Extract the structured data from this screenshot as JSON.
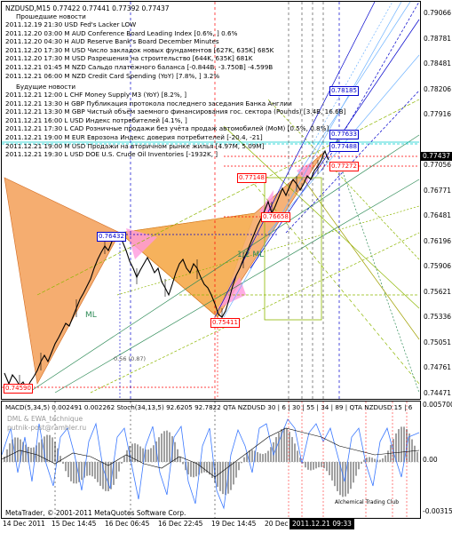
{
  "chart_header": "NZDUSD,M15  0.77422 0.77441 0.77392 0.77437",
  "news": {
    "past_title": "Прошедшие новости",
    "past": [
      "2011.12.19 21:30    USD Fed's Lacker  LOW",
      "2011.12.20 03:00 M AUD Conference Board Leading Index [0.6%, ] 0.6%",
      "2011.12.20 04:30 H AUD Reserve Bank's Board December Minutes",
      "2011.12.20 17:30 M USD Число закладок новых фундаментов [627K, 635K] 685K",
      "2011.12.20 17:30 M USD Разрешения на строительство [644K, 635K] 681K",
      "2011.12.21 01:45 M NZD Сальдо платёжного баланса [-0.844B, -3.750B] -4.599B",
      "2011.12.21 06:00 M NZD Credit Card Spending (YoY) [7.8%, ] 3.2%"
    ],
    "future_title": "Будущие новости",
    "future": [
      "2011.12.21 12:00 L CHF Money Supply M3 (YoY) [8.2%, ]",
      "2011.12.21 13:30 H GBP Публикация протокола последнего заседания Банка Англии",
      "2011.12.21 13:30 M GBP Чистый объём заемного финансирования гос. сектора (Pounds) [3.4B, 16.6B]",
      "2011.12.21 16:00 L USD Индекс потребителей [4.1%, ]",
      "2011.12.21 17:30 L CAD Розничные продажи без учёта продаж автомобилей (MoM) [0.5%, 0.8%]",
      "2011.12.21 19:00 M EUR Еврозона Индекс доверия потребителей [-20.4, -21]",
      "2011.12.21 19:00 M USD Продажи на вторичном рынке жилья [4.97M, 5.09M]",
      "2011.12.21 19:30 L USD DOE U.S. Crude Oil Inventories [-1932K, ]"
    ]
  },
  "price_axis": [
    "0.79066",
    "0.78781",
    "0.78481",
    "0.78206",
    "0.77916",
    "0.77437",
    "0.77056",
    "0.76771",
    "0.76481",
    "0.76196",
    "0.75906",
    "0.75621",
    "0.75336",
    "0.75051",
    "0.74761",
    "0.74471"
  ],
  "current_price": "0.77437",
  "price_labels": {
    "p1": "0.78185",
    "p2": "0.77633",
    "p3": "0.77488",
    "p4": "0.77272",
    "p5": "0.77148",
    "p6": "0.76432",
    "p7": "0.75411",
    "p8": "0.74590",
    "p9": "0.76658"
  },
  "chart_annotations": {
    "ml": "ML",
    "half": "1/2 ML",
    "fib": "0.56 (0.87)"
  },
  "macd": {
    "header": "MACD(5,34,5) 0.002491 0.002262  Stoch(34,13,5) 92.6205 92.7822  QTA NZDUSD 30 | 6 | 30 | 55 | 34 | 89 | QTA NZDUSD 15 | 6",
    "watermark1": "DML & EWA_technique",
    "watermark2": "putnik-post@rambler.ru",
    "copyright": "MetaTrader, © 2001-2011 MetaQuotes Software Corp.",
    "alchemy": "Alchemical Trading Club",
    "axis": [
      "0.005700",
      "0.00",
      "-0.00315"
    ]
  },
  "time_axis": [
    "14 Dec 2011",
    "15 Dec 14:45",
    "16 Dec 06:45",
    "16 Dec 22:45",
    "19 Dec 14:45",
    "20 Dec 06:45",
    "2011.12.21 09:33"
  ],
  "current_time": "2011.12.21 09:33",
  "colors": {
    "orange": "#f4a460",
    "yellow": "#ffff33",
    "pink": "#ff88cc",
    "red": "#ff0000",
    "blue": "#0000cc",
    "lightblue": "#6fb3ff",
    "green": "#2e8b57",
    "olive": "#8db600"
  }
}
